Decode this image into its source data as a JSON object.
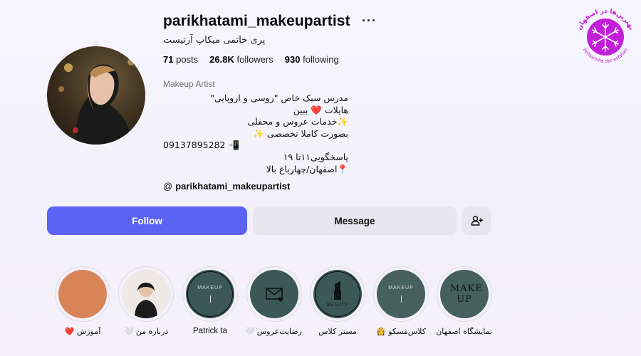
{
  "profile": {
    "username": "parikhatami_makeupartist",
    "more_glyph": "···",
    "full_name": "پری خاتمی میکاپ آرتیست",
    "stats": {
      "posts_value": "71",
      "posts_label": "posts",
      "followers_value": "26.8K",
      "followers_label": "followers",
      "following_value": "930",
      "following_label": "following"
    },
    "category": "Makeup Artist",
    "bio_lines": [
      "مدرس سبک خاص \"روسی و اروپایی\"",
      "هایلات ❤️ ببین",
      "✨خدمات عروس و محفلی",
      "بصورت کاملا تخصصی ✨",
      "09137895282 📲",
      "پاسخگویی۱۱تا ۱۹",
      "📍اصفهان/چهارباغ بالا"
    ],
    "threads_handle": "parikhatami_makeupartist",
    "threads_glyph": "@"
  },
  "actions": {
    "follow_label": "Follow",
    "message_label": "Message",
    "add_icon": "person-add-icon"
  },
  "highlights": [
    {
      "label": "آموزش ❤️",
      "cover": "solid-orange",
      "cover_color": "#d98458"
    },
    {
      "label": "درباره من 🤍",
      "cover": "photo"
    },
    {
      "label": "Patrick ta",
      "cover": "makeup-text",
      "cover_text": "MAKEUP",
      "cover_color": "#3b5854"
    },
    {
      "label": "رضایت‌عروس 🤍",
      "cover": "envelope",
      "cover_color": "#3b5854"
    },
    {
      "label": "مستر کلاس",
      "cover": "lipstick",
      "cover_text": "BEAUTY",
      "cover_color": "#3b5854"
    },
    {
      "label": "کلاس‌مسکو 👸",
      "cover": "makeup-text",
      "cover_text": "MAKEUP",
      "cover_color": "#46605c"
    },
    {
      "label": "نمایشگاه اصفهان",
      "cover": "make-up-big",
      "cover_text": "MAKE UP",
      "cover_color": "#46605c"
    }
  ],
  "watermark": {
    "text_top": "بهترین‌ها در اصفهان",
    "text_bottom": "behtarinha dar esfahan",
    "color": "#c21fd8"
  }
}
